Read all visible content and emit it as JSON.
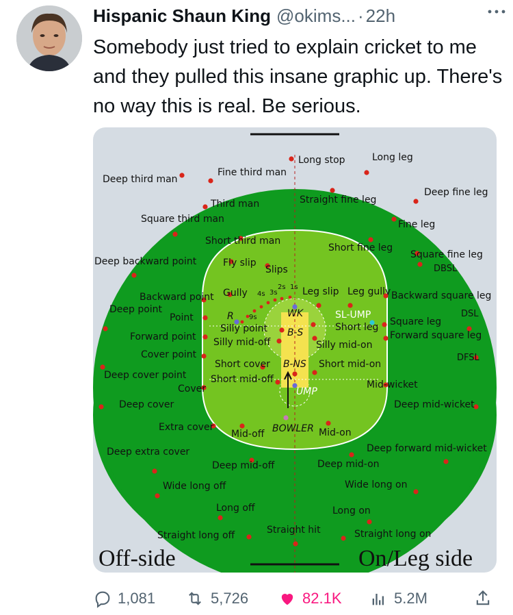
{
  "tweet": {
    "display_name": "Hispanic Shaun King",
    "handle": "@okims...",
    "separator": "·",
    "time": "22h",
    "text": "Somebody just tried to explain cricket to me and they pulled this insane graphic up. There's no way this is real. Be serious."
  },
  "graphic": {
    "bottom_left_label": "Off-side",
    "bottom_right_label": "On/Leg side",
    "colors": {
      "outfield": "#0f9b1f",
      "infield": "#74c421",
      "pitch": "#f4e24f",
      "background": "#d5dce3",
      "fielder": "#d9251a",
      "umpire": "#2ec7d6"
    },
    "fielders": [
      "Long stop",
      "Long leg",
      "Fine third man",
      "Deep third man",
      "Deep fine leg",
      "Straight fine leg",
      "Third man",
      "Square third man",
      "Fine leg",
      "Short third man",
      "Short fine leg",
      "Square fine leg",
      "Deep backward point",
      "Fly slip",
      "Slips",
      "DBSL",
      "Gully",
      "Leg slip",
      "Leg gully",
      "Backward point",
      "Backward square leg",
      "Deep point",
      "Point",
      "WK",
      "SL-UMP",
      "DSL",
      "Silly point",
      "Short leg",
      "Square leg",
      "Forward point",
      "Silly mid-off",
      "Silly mid-on",
      "Forward square leg",
      "Cover point",
      "DFSL",
      "Short cover",
      "B-NS",
      "Short mid-on",
      "Deep cover point",
      "Short mid-off",
      "Cover",
      "Mid-wicket",
      "Deep cover",
      "UMP",
      "Deep mid-wicket",
      "Extra cover",
      "BOWLER",
      "Mid-off",
      "Mid-on",
      "Deep extra cover",
      "Deep forward mid-wicket",
      "Deep mid-off",
      "Deep mid-on",
      "Wide long off",
      "Wide long on",
      "Long off",
      "Long on",
      "Straight long off",
      "Straight hit",
      "Straight long on",
      "R",
      "9s",
      "4s",
      "3s",
      "2s",
      "1s",
      "B-S"
    ]
  },
  "actions": {
    "replies": "1,081",
    "reposts": "5,726",
    "likes": "82.1K",
    "views": "5.2M"
  }
}
